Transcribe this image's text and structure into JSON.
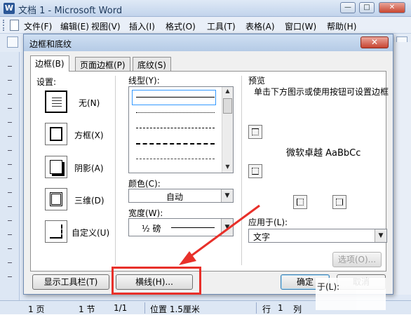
{
  "window": {
    "title": "文档 1 - Microsoft Word",
    "icon": "word-icon",
    "buttons": {
      "minimize": "—",
      "restore": "□",
      "close": "✕"
    }
  },
  "menu": [
    {
      "label": "文件(F)"
    },
    {
      "label": "编辑(E)"
    },
    {
      "label": "视图(V)"
    },
    {
      "label": "插入(I)"
    },
    {
      "label": "格式(O)"
    },
    {
      "label": "工具(T)"
    },
    {
      "label": "表格(A)"
    },
    {
      "label": "窗口(W)"
    },
    {
      "label": "帮助(H)"
    }
  ],
  "dialog": {
    "title": "边框和底纹",
    "close": "✕",
    "tabs": [
      {
        "label": "边框(B)",
        "active": true
      },
      {
        "label": "页面边框(P)",
        "active": false
      },
      {
        "label": "底纹(S)",
        "active": false
      }
    ],
    "settings": {
      "label": "设置:",
      "items": [
        {
          "label": "无(N)",
          "icon": "border-none-icon"
        },
        {
          "label": "方框(X)",
          "icon": "border-box-icon"
        },
        {
          "label": "阴影(A)",
          "icon": "border-shadow-icon"
        },
        {
          "label": "三维(D)",
          "icon": "border-3d-icon"
        },
        {
          "label": "自定义(U)",
          "icon": "border-custom-icon"
        }
      ]
    },
    "line_style": {
      "label": "线型(Y):"
    },
    "color": {
      "label": "颜色(C):",
      "value": "自动"
    },
    "width": {
      "label": "宽度(W):",
      "value": "½ 磅"
    },
    "preview": {
      "label": "预览",
      "hint": "单击下方图示或使用按钮可设置边框",
      "sample": "微软卓越  AaBbCc"
    },
    "apply_to": {
      "label": "应用于(L):",
      "value": "文字"
    },
    "options_button": "选项(O)...",
    "show_toolbar_button": "显示工具栏(T)",
    "horizontal_line_button": "横线(H)...",
    "ok_button": "确定",
    "cancel_button": "取消"
  },
  "statusbar": {
    "page": "1 页",
    "section": "1 节",
    "pages": "1/1",
    "position": "位置 1.5厘米",
    "line": "行",
    "line_no": "1",
    "col": "列"
  },
  "overlay": {
    "partial_text": "于(L):"
  },
  "colors": {
    "annotation": "#e8302a",
    "selection": "#3399ff"
  }
}
